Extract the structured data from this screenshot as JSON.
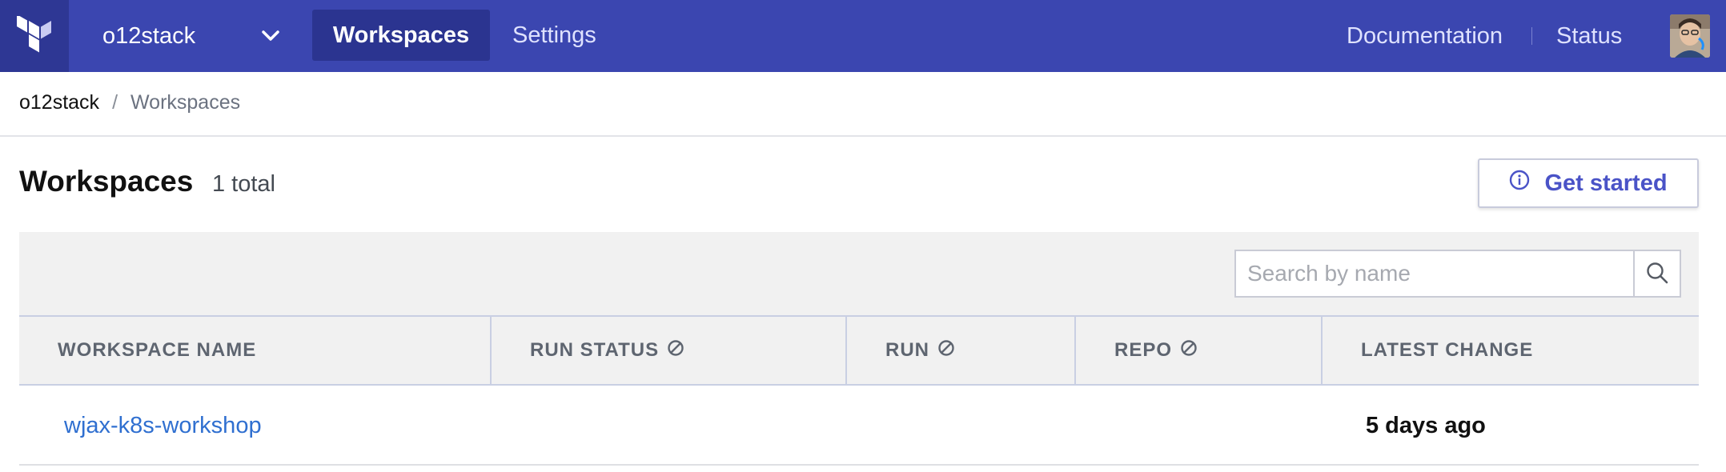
{
  "nav": {
    "org_name": "o12stack",
    "tabs": [
      {
        "label": "Workspaces",
        "active": true
      },
      {
        "label": "Settings",
        "active": false
      }
    ],
    "links": {
      "documentation": "Documentation",
      "status": "Status"
    },
    "icons": {
      "logo": "terraform-logo-icon",
      "org_menu": "chevron-down-icon",
      "avatar": "user-avatar"
    },
    "colors": {
      "nav_bg": "#3b46b0",
      "logo_bg": "#2e3794",
      "active_tab_bg": "#2b3490"
    }
  },
  "breadcrumb": {
    "items": [
      "o12stack",
      "Workspaces"
    ],
    "separator": "/"
  },
  "page": {
    "title": "Workspaces",
    "count": "1 total",
    "get_started_label": "Get started",
    "get_started_icon": "info-circle-icon"
  },
  "search": {
    "placeholder": "Search by name",
    "value": "",
    "icon": "search-icon"
  },
  "table": {
    "columns": [
      {
        "label": "WORKSPACE NAME",
        "sort_disabled_icon": false
      },
      {
        "label": "RUN STATUS",
        "sort_disabled_icon": true
      },
      {
        "label": "RUN",
        "sort_disabled_icon": true
      },
      {
        "label": "REPO",
        "sort_disabled_icon": true
      },
      {
        "label": "LATEST CHANGE",
        "sort_disabled_icon": false
      }
    ],
    "rows": [
      {
        "name": "wjax-k8s-workshop",
        "run_status": "",
        "run": "",
        "repo": "",
        "latest_change": "5 days ago"
      }
    ],
    "colors": {
      "link": "#2f6fd0",
      "header_text": "#5e6570"
    }
  }
}
